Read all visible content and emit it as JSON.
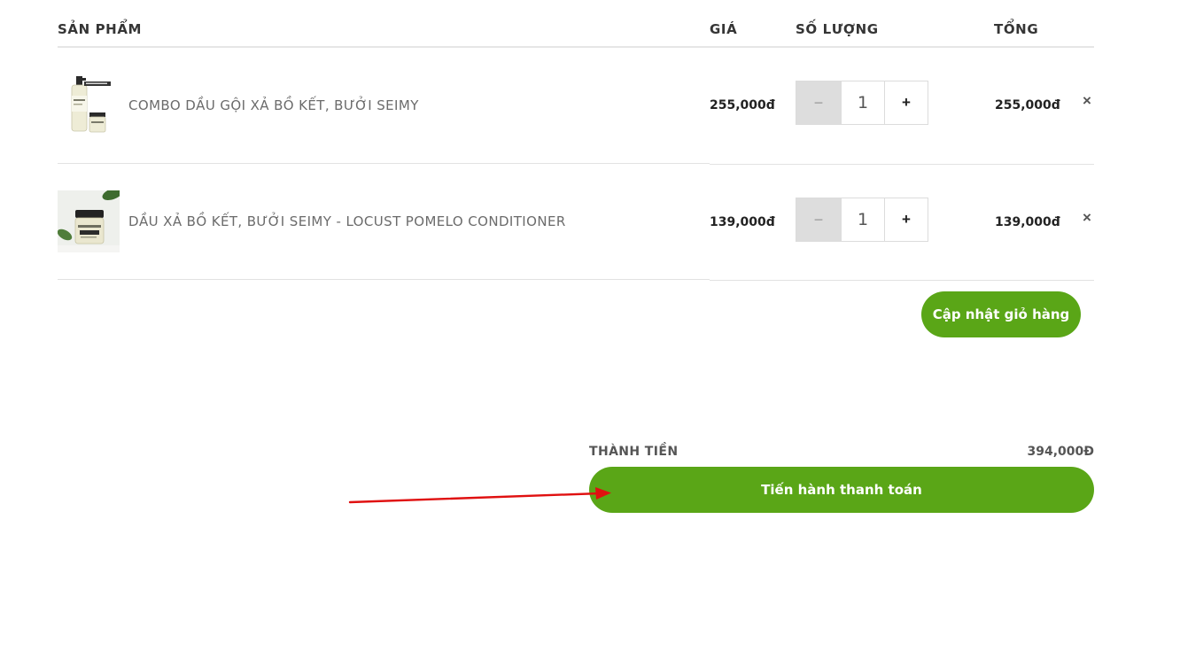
{
  "cart": {
    "headers": {
      "product": "SẢN PHẨM",
      "price": "GIÁ",
      "quantity": "SỐ LƯỢNG",
      "total": "TỔNG"
    },
    "items": [
      {
        "name": "COMBO DẦU GỘI XẢ BỒ KẾT, BƯỞI SEIMY",
        "price": "255,000đ",
        "quantity": "1",
        "subtotal": "255,000đ",
        "minus": "−",
        "plus": "+",
        "remove": "×"
      },
      {
        "name": "DẦU XẢ BỒ KẾT, BƯỞI SEIMY - LOCUST POMELO CONDITIONER",
        "price": "139,000đ",
        "quantity": "1",
        "subtotal": "139,000đ",
        "minus": "−",
        "plus": "+",
        "remove": "×"
      }
    ],
    "update_button": "Cập nhật giỏ hàng"
  },
  "summary": {
    "total_label": "THÀNH TIỀN",
    "total_value": "394,000Đ",
    "checkout_button": "Tiến hành thanh toán"
  },
  "colors": {
    "accent_green": "#5aa617",
    "annotation_arrow": "#e01010"
  }
}
